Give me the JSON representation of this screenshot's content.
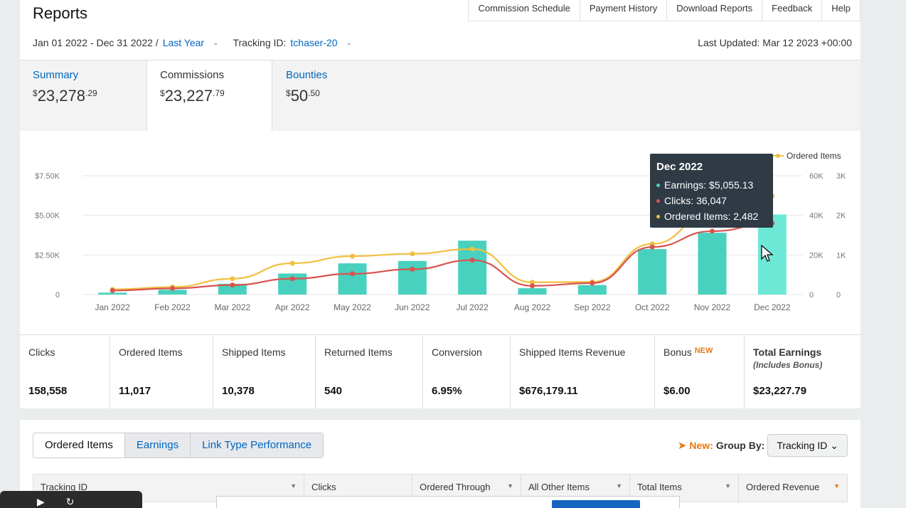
{
  "header": {
    "title": "Reports",
    "links": [
      "Commission Schedule",
      "Payment History",
      "Download Reports",
      "Feedback",
      "Help"
    ],
    "date_range": "Jan 01 2022 - Dec 31 2022 /",
    "period": "Last Year",
    "tracking_label": "Tracking ID:",
    "tracking_id": "tchaser-20",
    "last_updated": "Last Updated: Mar 12 2023 +00:00"
  },
  "summary_tabs": [
    {
      "label": "Summary",
      "currency": "$",
      "dollars": "23,278",
      "cents": ".29"
    },
    {
      "label": "Commissions",
      "currency": "$",
      "dollars": "23,227",
      "cents": ".79"
    },
    {
      "label": "Bounties",
      "currency": "$",
      "dollars": "50",
      "cents": ".50"
    }
  ],
  "chart_data": {
    "type": "bar",
    "categories": [
      "Jan 2022",
      "Feb 2022",
      "Mar 2022",
      "Apr 2022",
      "May 2022",
      "Jun 2022",
      "Jul 2022",
      "Aug 2022",
      "Sep 2022",
      "Oct 2022",
      "Nov 2022",
      "Dec 2022"
    ],
    "series": [
      {
        "name": "Earnings",
        "type": "bar",
        "axis": "left",
        "color": "#48d1be",
        "values": [
          120,
          300,
          680,
          1330,
          1970,
          2120,
          3400,
          400,
          600,
          2870,
          3900,
          5055.13
        ]
      },
      {
        "name": "Clicks",
        "type": "line",
        "axis": "right1",
        "color": "#d9534f",
        "values": [
          2000,
          3100,
          4800,
          8000,
          10500,
          12800,
          17400,
          4400,
          5800,
          24000,
          32000,
          36047
        ]
      },
      {
        "name": "Ordered Items",
        "type": "line",
        "axis": "right2",
        "color": "#f0c040",
        "values": [
          130,
          190,
          400,
          790,
          970,
          1030,
          1150,
          310,
          320,
          1280,
          2050,
          2482
        ]
      }
    ],
    "y_left": {
      "ticks": [
        "0",
        "$2.50K",
        "$5.00K",
        "$7.50K"
      ],
      "range": [
        0,
        7500
      ]
    },
    "y_right1": {
      "ticks": [
        "0",
        "20K",
        "40K",
        "60K"
      ],
      "range": [
        0,
        60000
      ]
    },
    "y_right2": {
      "ticks": [
        "0",
        "1K",
        "2K",
        "3K"
      ],
      "range": [
        0,
        3000
      ]
    },
    "legend_visible": "Ordered Items",
    "grid": true
  },
  "tooltip": {
    "title": "Dec 2022",
    "rows": [
      {
        "text": "Earnings: $5,055.13",
        "color": "#48d1be"
      },
      {
        "text": "Clicks: 36,047",
        "color": "#d9534f"
      },
      {
        "text": "Ordered Items: 2,482",
        "color": "#f0c040"
      }
    ]
  },
  "metrics": [
    {
      "label": "Clicks",
      "value": "158,558"
    },
    {
      "label": "Ordered Items",
      "value": "11,017"
    },
    {
      "label": "Shipped Items",
      "value": "10,378"
    },
    {
      "label": "Returned Items",
      "value": "540"
    },
    {
      "label": "Conversion",
      "value": "6.95%"
    },
    {
      "label": "Shipped Items Revenue",
      "value": "$676,179.11"
    },
    {
      "label": "Bonus",
      "badge": "NEW",
      "value": "$6.00"
    },
    {
      "label": "Total Earnings",
      "sub": "(Includes Bonus)",
      "value": "$23,227.79"
    }
  ],
  "bottom": {
    "tabs": [
      "Ordered Items",
      "Earnings",
      "Link Type Performance"
    ],
    "new_label": "New:",
    "group_label": "Group By:",
    "group_value": "Tracking ID",
    "columns": [
      "Tracking ID",
      "Clicks",
      "Ordered Through",
      "All Other Items",
      "Total Items",
      "Ordered Revenue"
    ]
  }
}
